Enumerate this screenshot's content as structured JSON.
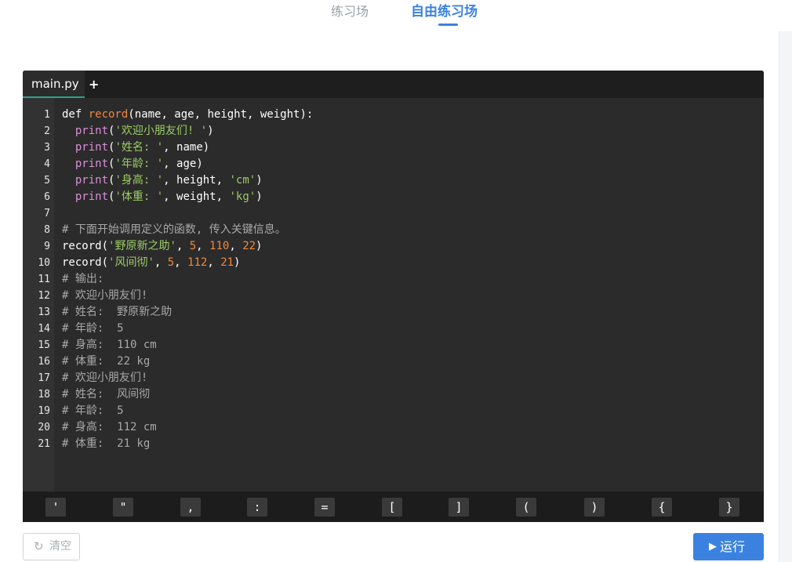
{
  "tabs": [
    "练习场",
    "自由练习场"
  ],
  "editor": {
    "file_tab": "main.py",
    "add_tab": "+",
    "line_numbers": [
      "1",
      "2",
      "3",
      "4",
      "5",
      "6",
      "7",
      "8",
      "9",
      "10",
      "11",
      "12",
      "13",
      "14",
      "15",
      "16",
      "17",
      "18",
      "19",
      "20",
      "21"
    ]
  },
  "code_lines": [
    [
      [
        "kw",
        "def "
      ],
      [
        "fn",
        "record"
      ],
      [
        "kw",
        "(name, age, height, weight):"
      ]
    ],
    [
      [
        "kw",
        "  "
      ],
      [
        "bi",
        "print"
      ],
      [
        "kw",
        "("
      ],
      [
        "str",
        "'欢迎小朋友们! '"
      ],
      [
        "kw",
        ")"
      ]
    ],
    [
      [
        "kw",
        "  "
      ],
      [
        "bi",
        "print"
      ],
      [
        "kw",
        "("
      ],
      [
        "str",
        "'姓名: '"
      ],
      [
        "kw",
        ", name)"
      ]
    ],
    [
      [
        "kw",
        "  "
      ],
      [
        "bi",
        "print"
      ],
      [
        "kw",
        "("
      ],
      [
        "str",
        "'年龄: '"
      ],
      [
        "kw",
        ", age)"
      ]
    ],
    [
      [
        "kw",
        "  "
      ],
      [
        "bi",
        "print"
      ],
      [
        "kw",
        "("
      ],
      [
        "str",
        "'身高: '"
      ],
      [
        "kw",
        ", height, "
      ],
      [
        "str",
        "'cm'"
      ],
      [
        "kw",
        ")"
      ]
    ],
    [
      [
        "kw",
        "  "
      ],
      [
        "bi",
        "print"
      ],
      [
        "kw",
        "("
      ],
      [
        "str",
        "'体重: '"
      ],
      [
        "kw",
        ", weight, "
      ],
      [
        "str",
        "'kg'"
      ],
      [
        "kw",
        ")"
      ]
    ],
    [],
    [
      [
        "cm",
        "# 下面开始调用定义的函数, 传入关键信息。"
      ]
    ],
    [
      [
        "kw",
        "record("
      ],
      [
        "str",
        "'野原新之助'"
      ],
      [
        "kw",
        ", "
      ],
      [
        "num",
        "5"
      ],
      [
        "kw",
        ", "
      ],
      [
        "num",
        "110"
      ],
      [
        "kw",
        ", "
      ],
      [
        "num",
        "22"
      ],
      [
        "kw",
        ")"
      ]
    ],
    [
      [
        "kw",
        "record("
      ],
      [
        "str",
        "'风间彻'"
      ],
      [
        "kw",
        ", "
      ],
      [
        "num",
        "5"
      ],
      [
        "kw",
        ", "
      ],
      [
        "num",
        "112"
      ],
      [
        "kw",
        ", "
      ],
      [
        "num",
        "21"
      ],
      [
        "kw",
        ")"
      ]
    ],
    [
      [
        "cm",
        "# 输出:"
      ]
    ],
    [
      [
        "cm",
        "# 欢迎小朋友们!"
      ]
    ],
    [
      [
        "cm",
        "# 姓名:  野原新之助"
      ]
    ],
    [
      [
        "cm",
        "# 年龄:  5"
      ]
    ],
    [
      [
        "cm",
        "# 身高:  110 cm"
      ]
    ],
    [
      [
        "cm",
        "# 体重:  22 kg"
      ]
    ],
    [
      [
        "cm",
        "# 欢迎小朋友们!"
      ]
    ],
    [
      [
        "cm",
        "# 姓名:  风间彻"
      ]
    ],
    [
      [
        "cm",
        "# 年龄:  5"
      ]
    ],
    [
      [
        "cm",
        "# 身高:  112 cm"
      ]
    ],
    [
      [
        "cm",
        "# 体重:  21 kg"
      ]
    ]
  ],
  "symbols": [
    "'",
    "\"",
    ",",
    ":",
    "=",
    "[",
    "]",
    "(",
    ")",
    "{",
    "}"
  ],
  "buttons": {
    "clear_icon": "↻",
    "clear_label": "清空",
    "run_icon": "▶",
    "run_label": "运行"
  },
  "colors": {
    "accent": "#3b82e0",
    "editor_bg": "#2b2b2b",
    "string": "#9ccc65",
    "function": "#f0883e",
    "builtin": "#d98fd6",
    "comment": "#a8a8a8"
  }
}
